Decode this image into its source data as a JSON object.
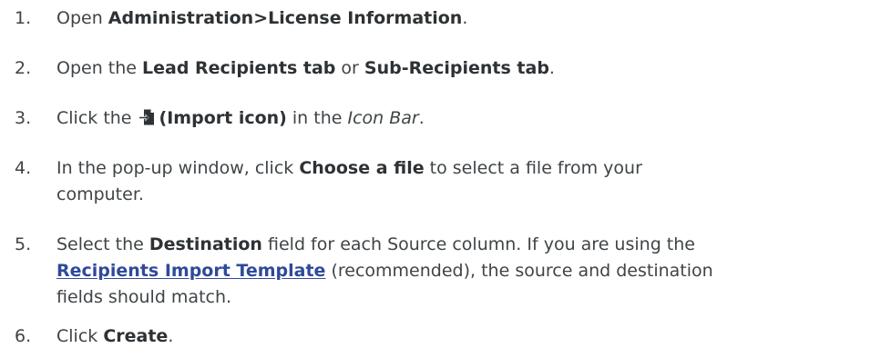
{
  "steps": [
    {
      "num": "1.",
      "pre": "Open ",
      "bold": "Administration>License Information",
      "post": "."
    },
    {
      "num": "2.",
      "pre": "Open the ",
      "bold1": "Lead Recipients tab",
      "mid": " or ",
      "bold2": "Sub-Recipients tab",
      "post": "."
    },
    {
      "num": "3.",
      "pre": "Click the ",
      "icon": "import-icon",
      "bold": "(Import icon)",
      "mid": " in the ",
      "italic": "Icon Bar",
      "post": "."
    },
    {
      "num": "4.",
      "pre": "In the pop-up window, click ",
      "bold": "Choose a file",
      "post_line1": " to select a file from your",
      "line2": "computer."
    },
    {
      "num": "5.",
      "pre": "Select the ",
      "bold": "Destination",
      "post_line1": " field for each Source column. If you are using the",
      "link": "Recipients Import Template",
      "post_line2": " (recommended), the source and destination",
      "line3": "fields should match."
    },
    {
      "num": "6.",
      "pre": "Click ",
      "bold": "Create",
      "post": "."
    }
  ],
  "colors": {
    "text": "#3f4447",
    "link": "#2f4a9a"
  }
}
